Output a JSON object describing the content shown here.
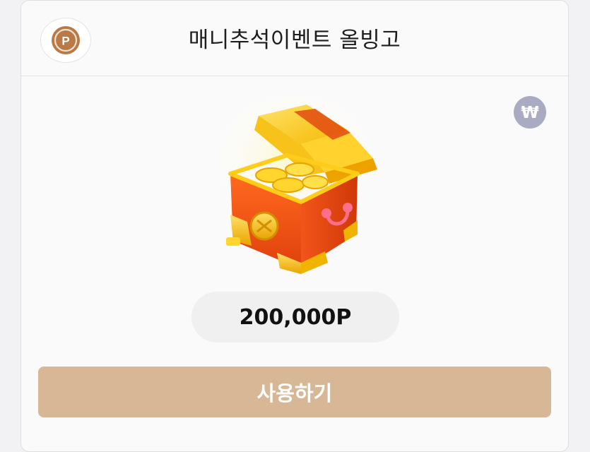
{
  "header": {
    "title": "매니추석이벤트 올빙고",
    "point_icon": "point-coin-icon",
    "point_symbol": "P"
  },
  "reward": {
    "image": "treasure-chest-image",
    "currency_icon": "won-icon",
    "currency_symbol": "₩",
    "amount": "200,000P"
  },
  "action": {
    "use_label": "사용하기"
  },
  "colors": {
    "button": "#d8b797",
    "accent_brown": "#b97a47",
    "won_badge": "#a9abc2",
    "pill": "#f0f0f0"
  }
}
